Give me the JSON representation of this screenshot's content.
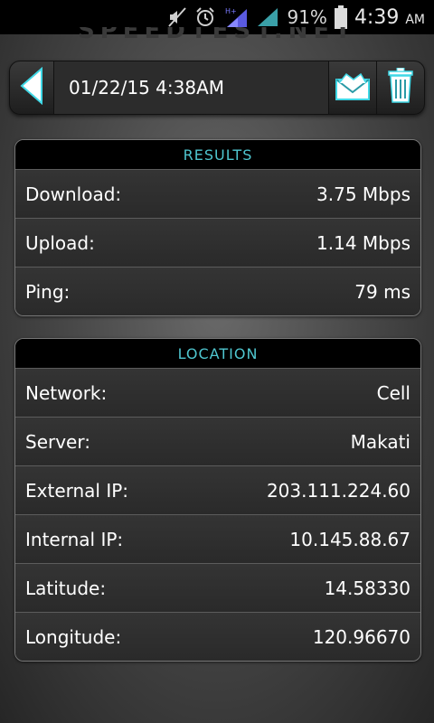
{
  "status_bar": {
    "battery_percent": "91%",
    "time": "4:39",
    "ampm": "AM",
    "icons": [
      "mute-icon",
      "alarm-icon",
      "hplus-signal-icon",
      "signal-icon",
      "battery-icon"
    ]
  },
  "watermark": "SPEEDTEST.NET",
  "header": {
    "title": "01/22/15 4:38AM",
    "icons": [
      "back-arrow-icon",
      "email-icon",
      "trash-icon"
    ],
    "accent_color": "#3fd8e6"
  },
  "results": {
    "heading": "RESULTS",
    "rows": [
      {
        "label": "Download:",
        "value": "3.75 Mbps"
      },
      {
        "label": "Upload:",
        "value": "1.14 Mbps"
      },
      {
        "label": "Ping:",
        "value": "79 ms"
      }
    ]
  },
  "location": {
    "heading": "LOCATION",
    "rows": [
      {
        "label": "Network:",
        "value": "Cell"
      },
      {
        "label": "Server:",
        "value": "Makati"
      },
      {
        "label": "External IP:",
        "value": "203.111.224.60"
      },
      {
        "label": "Internal IP:",
        "value": "10.145.88.67"
      },
      {
        "label": "Latitude:",
        "value": "14.58330"
      },
      {
        "label": "Longitude:",
        "value": "120.96670"
      }
    ]
  }
}
